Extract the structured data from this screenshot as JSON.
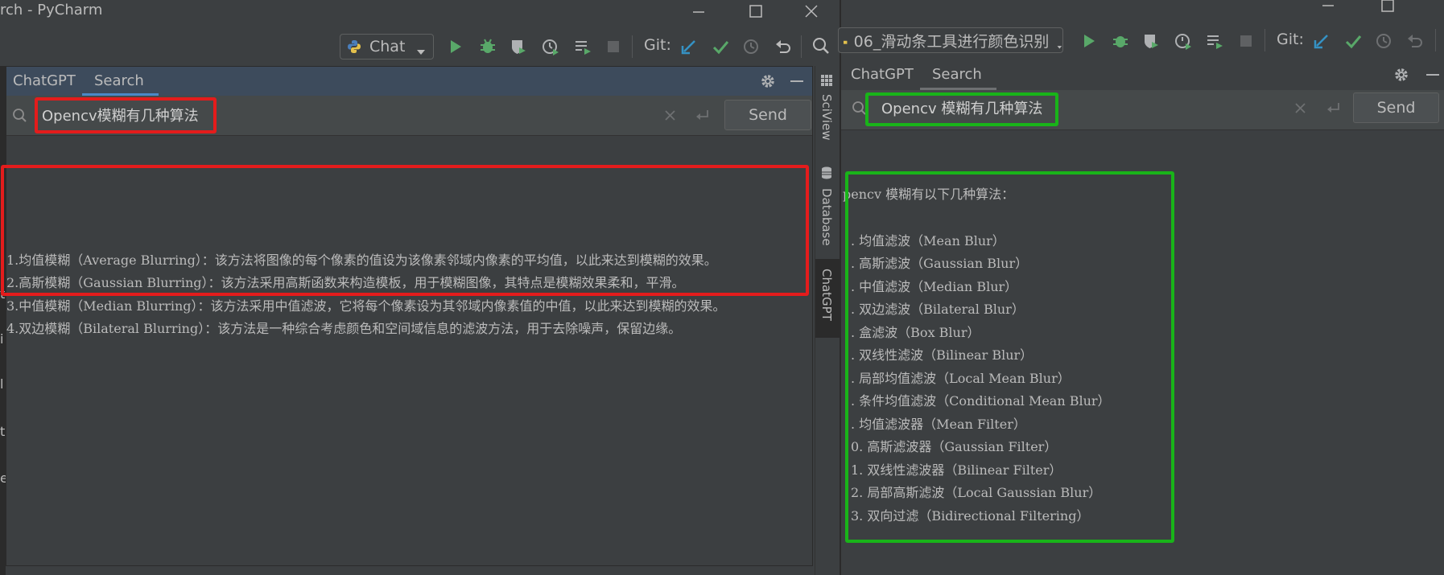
{
  "left_window": {
    "title": "rch - PyCharm",
    "run_config": "Chat",
    "git_label": "Git:",
    "tabs": [
      {
        "label": "ChatGPT"
      },
      {
        "label": "Search"
      }
    ],
    "search_value": "Opencv模糊有几种算法",
    "send_label": "Send",
    "answer_lines": [
      "1.均值模糊（Average Blurring）：该方法将图像的每个像素的值设为该像素邻域内像素的平均值，以此来达到模糊的效果。",
      "2.高斯模糊（Gaussian Blurring）：该方法采用高斯函数来构造模板，用于模糊图像，其特点是模糊效果柔和，平滑。",
      "3.中值模糊（Median Blurring）：该方法采用中值滤波，它将每个像素设为其邻域内像素值的中值，以此来达到模糊的效果。",
      "4.双边模糊（Bilateral Blurring）：该方法是一种综合考虑颜色和空间域信息的滤波方法，用于去除噪声，保留边缘。"
    ],
    "side_tabs": [
      {
        "label": "SciView"
      },
      {
        "label": "Database"
      },
      {
        "label": "ChatGPT"
      }
    ],
    "gutter_chars": [
      "t",
      "i",
      "l",
      "t",
      "e"
    ]
  },
  "right_window": {
    "run_config": "06_滑动条工具进行颜色识别",
    "git_label": "Git:",
    "tabs": [
      {
        "label": "ChatGPT"
      },
      {
        "label": "Search"
      }
    ],
    "search_value": "Opencv 模糊有几种算法",
    "send_label": "Send",
    "answer_intro": "pencv 模糊有以下几种算法：",
    "answer_lines": [
      ". 均值滤波（Mean Blur）",
      ". 高斯滤波（Gaussian Blur）",
      ". 中值滤波（Median Blur）",
      ". 双边滤波（Bilateral Blur）",
      ". 盒滤波（Box Blur）",
      ". 双线性滤波（Bilinear Blur）",
      ". 局部均值滤波（Local Mean Blur）",
      ". 条件均值滤波（Conditional Mean Blur）",
      ". 均值滤波器（Mean Filter）",
      "0. 高斯滤波器（Gaussian Filter）",
      "1. 双线性滤波器（Bilinear Filter）",
      "2. 局部高斯滤波（Local Gaussian Blur）",
      "3. 双向过滤（Bidirectional Filtering）"
    ]
  },
  "colors": {
    "annotation_red": "#e41c1c",
    "annotation_green": "#19b419",
    "run_green": "#59a869",
    "vcs_blue": "#3592c4",
    "tab_underline": "#4a88c7"
  }
}
